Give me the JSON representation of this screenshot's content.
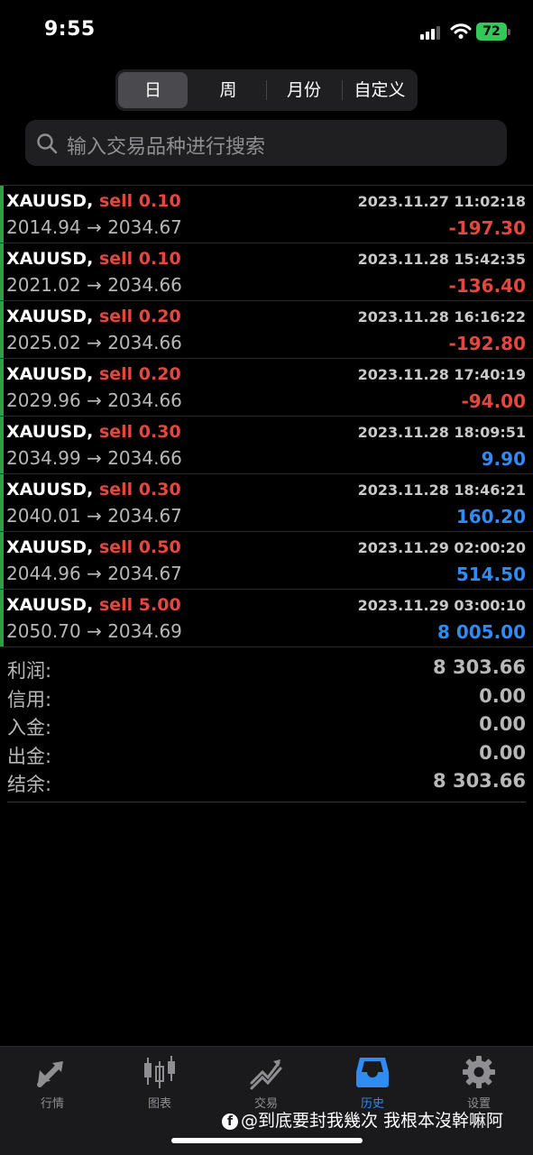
{
  "status": {
    "time": "9:55",
    "battery": "72"
  },
  "periods": {
    "day": "日",
    "week": "周",
    "month": "月份",
    "custom": "自定义"
  },
  "search": {
    "placeholder": "输入交易品种进行搜索"
  },
  "trades": [
    {
      "symbol": "XAUUSD,",
      "side": "sell",
      "volume": "0.10",
      "open": "2014.94",
      "close": "2034.67",
      "datetime": "2023.11.27 11:02:18",
      "profit": "-197.30"
    },
    {
      "symbol": "XAUUSD,",
      "side": "sell",
      "volume": "0.10",
      "open": "2021.02",
      "close": "2034.66",
      "datetime": "2023.11.28 15:42:35",
      "profit": "-136.40"
    },
    {
      "symbol": "XAUUSD,",
      "side": "sell",
      "volume": "0.20",
      "open": "2025.02",
      "close": "2034.66",
      "datetime": "2023.11.28 16:16:22",
      "profit": "-192.80"
    },
    {
      "symbol": "XAUUSD,",
      "side": "sell",
      "volume": "0.20",
      "open": "2029.96",
      "close": "2034.66",
      "datetime": "2023.11.28 17:40:19",
      "profit": "-94.00"
    },
    {
      "symbol": "XAUUSD,",
      "side": "sell",
      "volume": "0.30",
      "open": "2034.99",
      "close": "2034.66",
      "datetime": "2023.11.28 18:09:51",
      "profit": "9.90"
    },
    {
      "symbol": "XAUUSD,",
      "side": "sell",
      "volume": "0.30",
      "open": "2040.01",
      "close": "2034.67",
      "datetime": "2023.11.28 18:46:21",
      "profit": "160.20"
    },
    {
      "symbol": "XAUUSD,",
      "side": "sell",
      "volume": "0.50",
      "open": "2044.96",
      "close": "2034.67",
      "datetime": "2023.11.29 02:00:20",
      "profit": "514.50"
    },
    {
      "symbol": "XAUUSD,",
      "side": "sell",
      "volume": "5.00",
      "open": "2050.70",
      "close": "2034.69",
      "datetime": "2023.11.29 03:00:10",
      "profit": "8 005.00"
    }
  ],
  "summary": {
    "profit": {
      "label": "利润:",
      "value": "8 303.66"
    },
    "credit": {
      "label": "信用:",
      "value": "0.00"
    },
    "deposit": {
      "label": "入金:",
      "value": "0.00"
    },
    "withdrawal": {
      "label": "出金:",
      "value": "0.00"
    },
    "balance": {
      "label": "结余:",
      "value": "8 303.66"
    }
  },
  "tabs": {
    "quotes": "行情",
    "chart": "图表",
    "trade": "交易",
    "history": "历史",
    "settings": "设置"
  },
  "watermark": "@到底要封我幾次 我根本沒幹嘛阿",
  "colors": {
    "loss": "#e5473f",
    "gain": "#2f8cf5",
    "accent_bar": "#2ea043",
    "active_tab": "#2f8cf5"
  }
}
